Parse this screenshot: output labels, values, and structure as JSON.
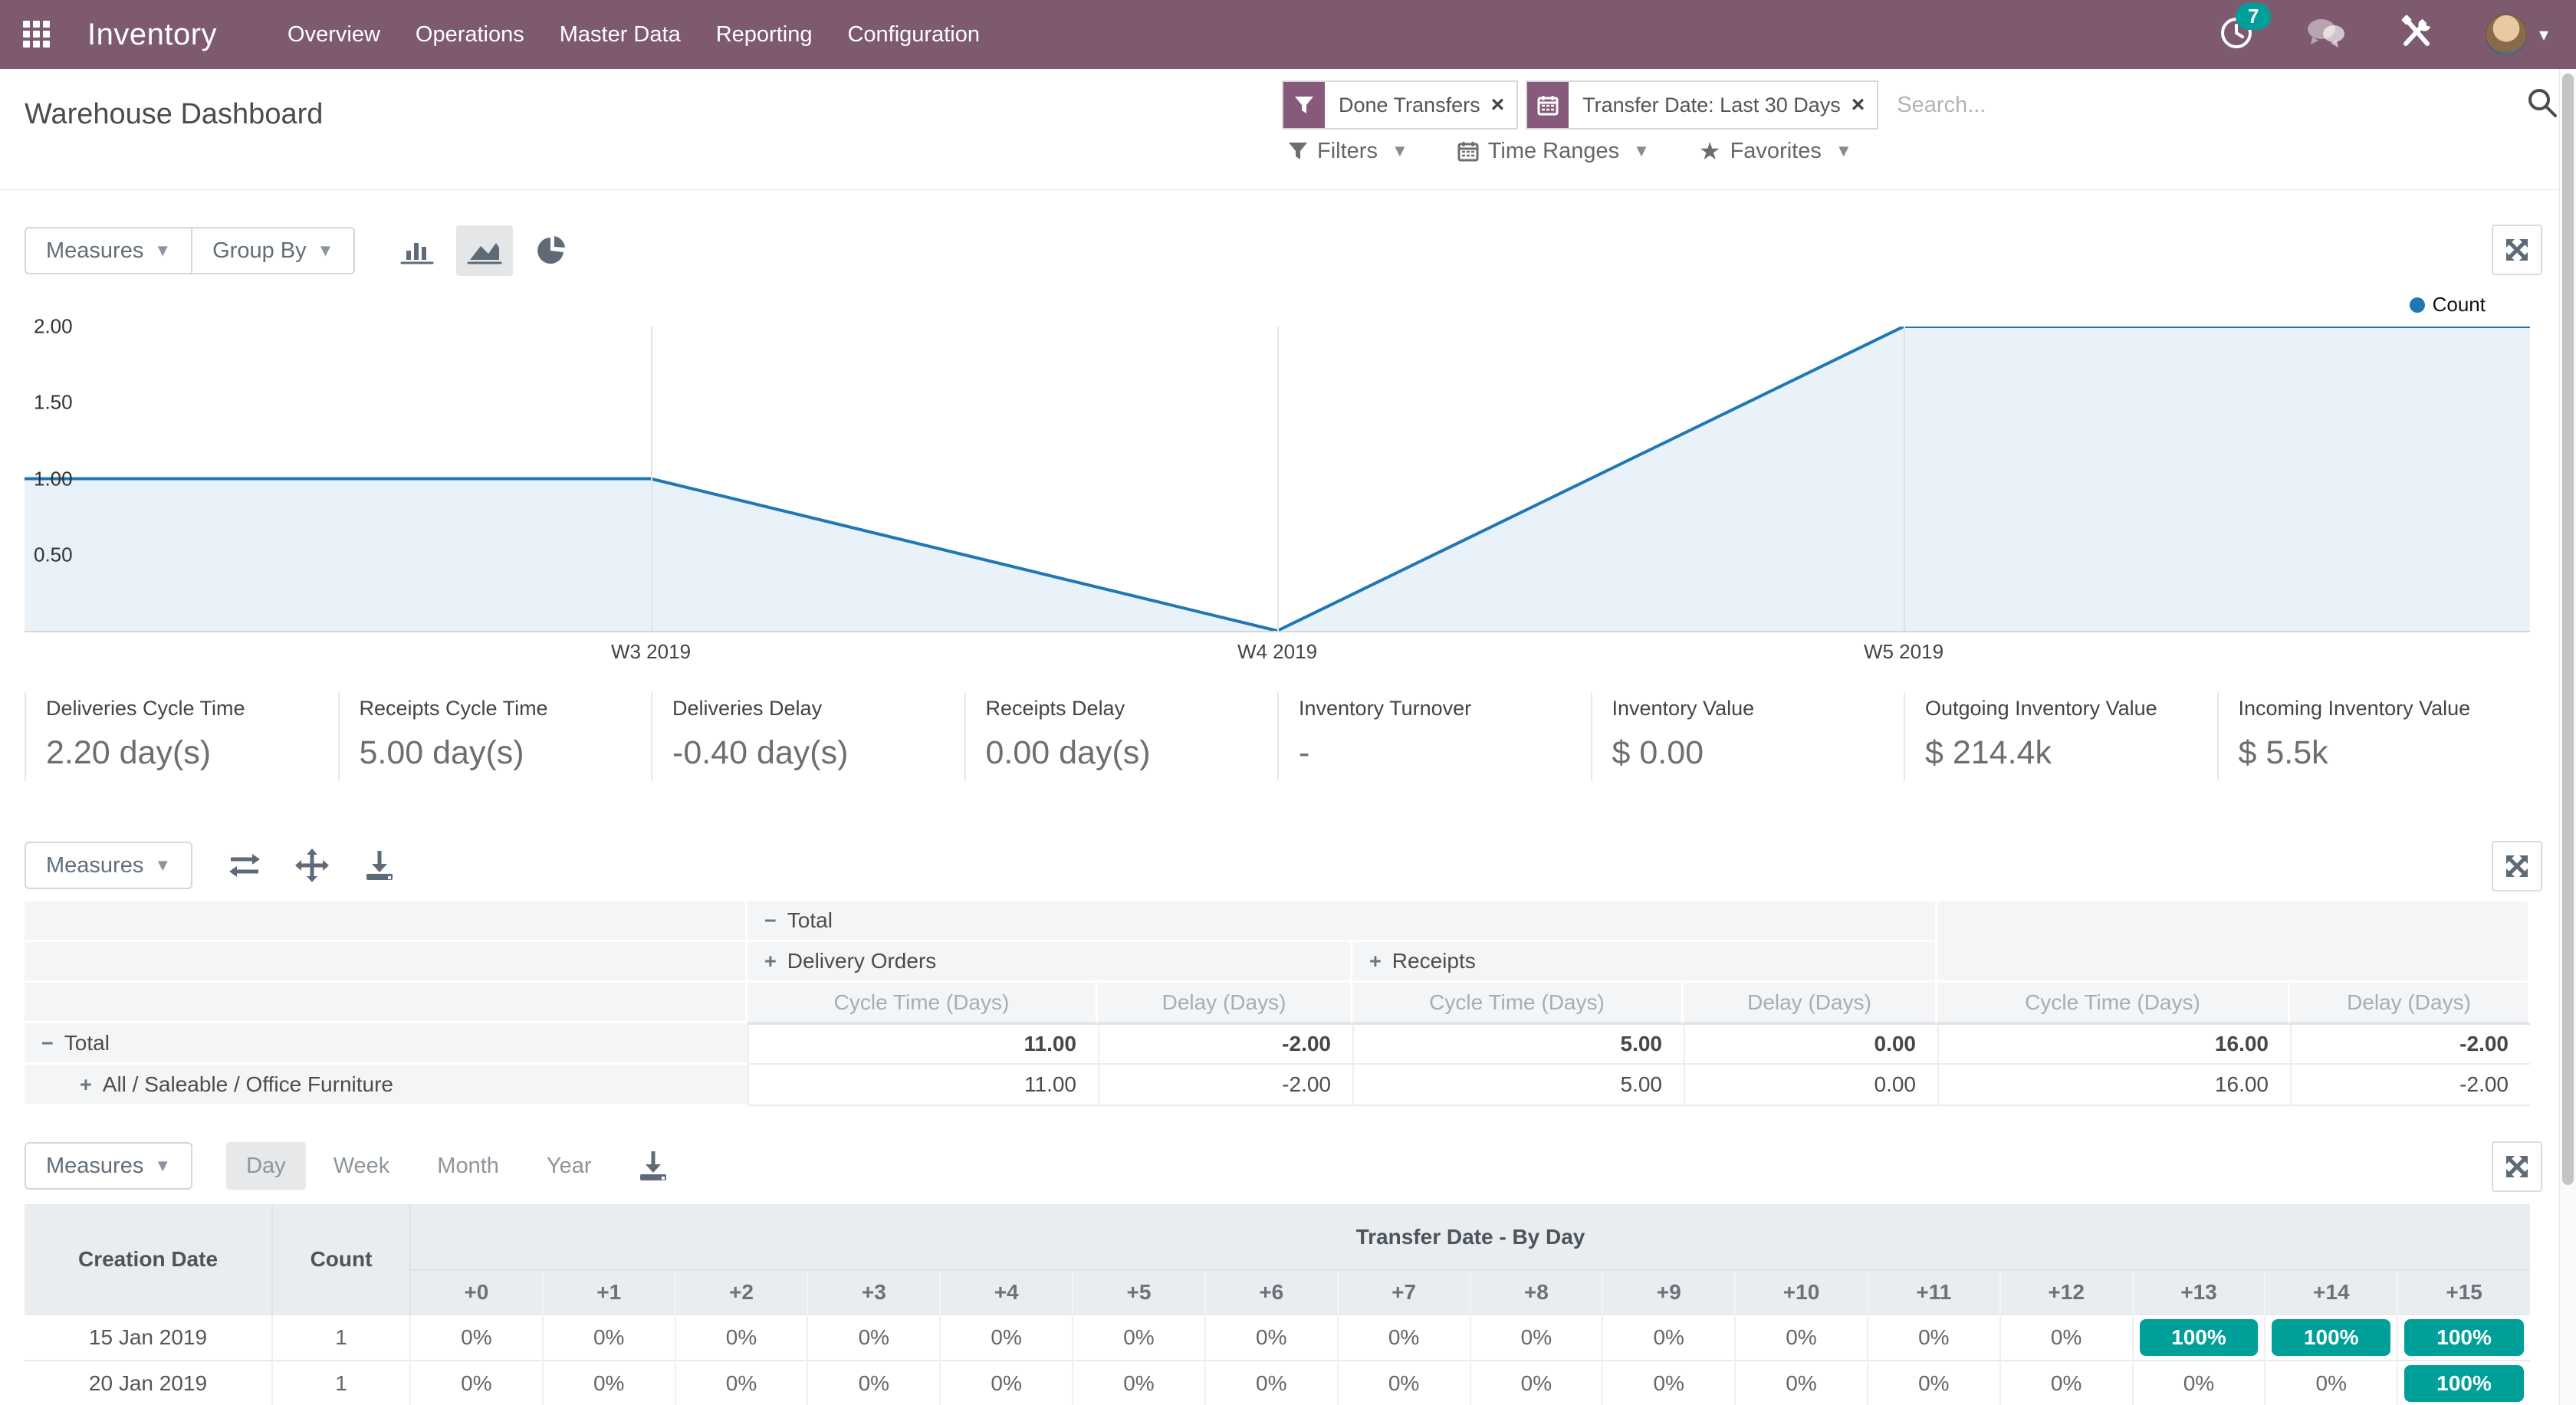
{
  "navbar": {
    "brand": "Inventory",
    "items": [
      "Overview",
      "Operations",
      "Master Data",
      "Reporting",
      "Configuration"
    ],
    "activity_badge": "7"
  },
  "control_panel": {
    "title": "Warehouse Dashboard",
    "facets": [
      {
        "icon": "filter-icon",
        "label": "Done Transfers",
        "remove": "×"
      },
      {
        "icon": "calendar-icon",
        "label": "Transfer Date: Last 30 Days",
        "remove": "×"
      }
    ],
    "search_placeholder": "Search...",
    "dropdowns": {
      "filters": "Filters",
      "time_ranges": "Time Ranges",
      "favorites": "Favorites"
    }
  },
  "graph_section": {
    "measures_label": "Measures",
    "group_by_label": "Group By",
    "legend": "Count",
    "chart_data": {
      "type": "area",
      "x": [
        "W3 2019",
        "W4 2019",
        "W5 2019"
      ],
      "series": [
        {
          "name": "Count",
          "values": [
            1,
            0,
            2
          ]
        }
      ],
      "title": "",
      "xlabel": "",
      "ylabel": "",
      "yticks": [
        "2.00",
        "1.50",
        "1.00",
        "0.50"
      ],
      "ytick_values": [
        2.0,
        1.5,
        1.0,
        0.5
      ],
      "ylim": [
        0,
        2
      ],
      "grid": "vertical-only",
      "legend_position": "top-right",
      "line_color": "#1f77b4",
      "fill_color": "#e9f1f9",
      "edge_extension": "flat"
    }
  },
  "kpis": [
    {
      "label": "Deliveries Cycle Time",
      "value": "2.20 day(s)"
    },
    {
      "label": "Receipts Cycle Time",
      "value": "5.00 day(s)"
    },
    {
      "label": "Deliveries Delay",
      "value": "-0.40 day(s)"
    },
    {
      "label": "Receipts Delay",
      "value": "0.00 day(s)"
    },
    {
      "label": "Inventory Turnover",
      "value": "-"
    },
    {
      "label": "Inventory Value",
      "value": "$ 0.00"
    },
    {
      "label": "Outgoing Inventory Value",
      "value": "$ 214.4k"
    },
    {
      "label": "Incoming Inventory Value",
      "value": "$ 5.5k"
    }
  ],
  "pivot_section": {
    "measures_label": "Measures",
    "header": {
      "total_label": "Total",
      "groups": [
        "Delivery Orders",
        "Receipts"
      ],
      "measures": [
        "Cycle Time (Days)",
        "Delay (Days)",
        "Cycle Time (Days)",
        "Delay (Days)",
        "Cycle Time (Days)",
        "Delay (Days)"
      ]
    },
    "rows": [
      {
        "label": "Total",
        "expander": "minus",
        "bold": true,
        "values": [
          "11.00",
          "-2.00",
          "5.00",
          "0.00",
          "16.00",
          "-2.00"
        ]
      },
      {
        "label": "All / Saleable / Office Furniture",
        "expander": "plus",
        "bold": false,
        "values": [
          "11.00",
          "-2.00",
          "5.00",
          "0.00",
          "16.00",
          "-2.00"
        ]
      }
    ]
  },
  "cohort_section": {
    "measures_label": "Measures",
    "intervals": [
      "Day",
      "Week",
      "Month",
      "Year"
    ],
    "active_interval": "Day",
    "table": {
      "title": "Transfer Date - By Day",
      "date_header": "Creation Date",
      "count_header": "Count",
      "offsets": [
        "+0",
        "+1",
        "+2",
        "+3",
        "+4",
        "+5",
        "+6",
        "+7",
        "+8",
        "+9",
        "+10",
        "+11",
        "+12",
        "+13",
        "+14",
        "+15"
      ],
      "rows": [
        {
          "date": "15 Jan 2019",
          "count": "1",
          "cells": [
            "0%",
            "0%",
            "0%",
            "0%",
            "0%",
            "0%",
            "0%",
            "0%",
            "0%",
            "0%",
            "0%",
            "0%",
            "0%",
            "100%",
            "100%",
            "100%"
          ]
        },
        {
          "date": "20 Jan 2019",
          "count": "1",
          "cells": [
            "0%",
            "0%",
            "0%",
            "0%",
            "0%",
            "0%",
            "0%",
            "0%",
            "0%",
            "0%",
            "0%",
            "0%",
            "0%",
            "0%",
            "0%",
            "100%"
          ]
        }
      ],
      "highlight_color": "#00a09a"
    }
  },
  "colors": {
    "navbar": "#7d5a70",
    "accent_purple": "#875a7b",
    "teal": "#00a09a",
    "chart_line": "#1f77b4"
  }
}
